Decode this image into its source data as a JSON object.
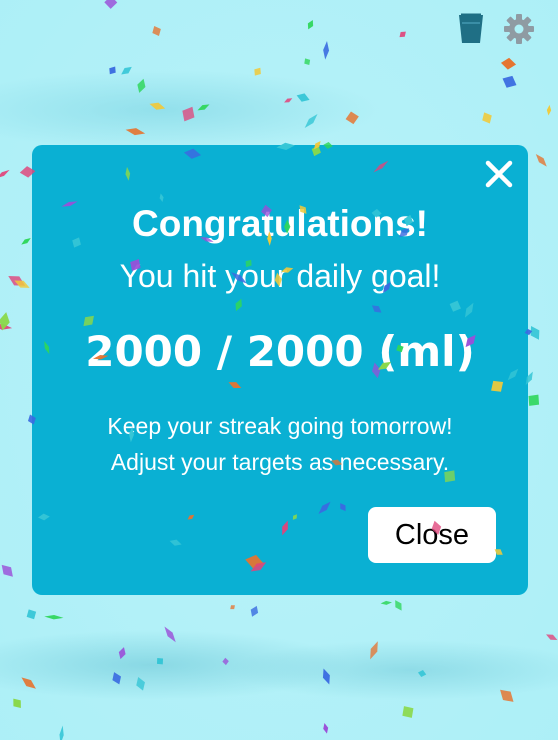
{
  "top_bar": {
    "icons": [
      "water-glass-icon",
      "gear-icon"
    ],
    "colors": {
      "glass": "#1f6f85",
      "gear": "#8f9ba3"
    }
  },
  "modal": {
    "title": "Congratulations!",
    "subtitle": "You hit your daily goal!",
    "amount": "2000 / 2000 (ml)",
    "message_line1": "Keep your streak going tomorrow!",
    "message_line2": "Adjust your targets as necessary.",
    "close_label": "Close",
    "close_icon": "close-icon",
    "colors": {
      "background": "#0ab0d3",
      "text": "#ffffff",
      "button": "#ffffff"
    }
  },
  "confetti_colors": [
    "#2fd65b",
    "#f0c93a",
    "#3a6be0",
    "#e0457b",
    "#8ad84a",
    "#e6732f",
    "#9a4fd8",
    "#36c6d6"
  ]
}
